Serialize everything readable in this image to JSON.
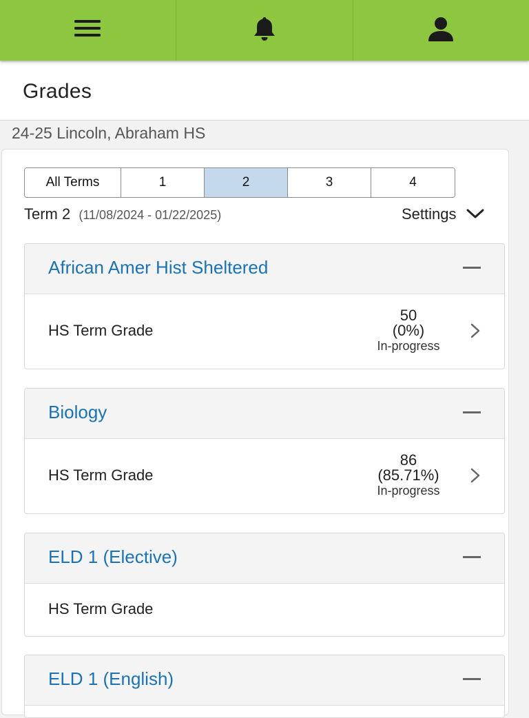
{
  "topbar": {
    "icons": [
      "menu-icon",
      "bell-icon",
      "user-icon"
    ]
  },
  "header": {
    "title": "Grades"
  },
  "school": "24-25 Lincoln, Abraham HS",
  "terms": {
    "items": [
      "All Terms",
      "1",
      "2",
      "3",
      "4"
    ],
    "selected": "2"
  },
  "term_info": {
    "label": "Term 2",
    "dates": "(11/08/2024 - 01/22/2025)"
  },
  "settings": {
    "label": "Settings"
  },
  "courses": [
    {
      "title": "African Amer Hist Sheltered",
      "row_label": "HS Term Grade",
      "score": "50",
      "percent": "(0%)",
      "status": "In-progress"
    },
    {
      "title": "Biology",
      "row_label": "HS Term Grade",
      "score": "86",
      "percent": "(85.71%)",
      "status": "In-progress"
    },
    {
      "title": "ELD 1 (Elective)",
      "row_label": "HS Term Grade"
    },
    {
      "title": "ELD 1 (English)"
    }
  ],
  "colors": {
    "topbar": "#8dc63f",
    "link": "#1a73b8",
    "active_term": "#c5d9ec"
  }
}
